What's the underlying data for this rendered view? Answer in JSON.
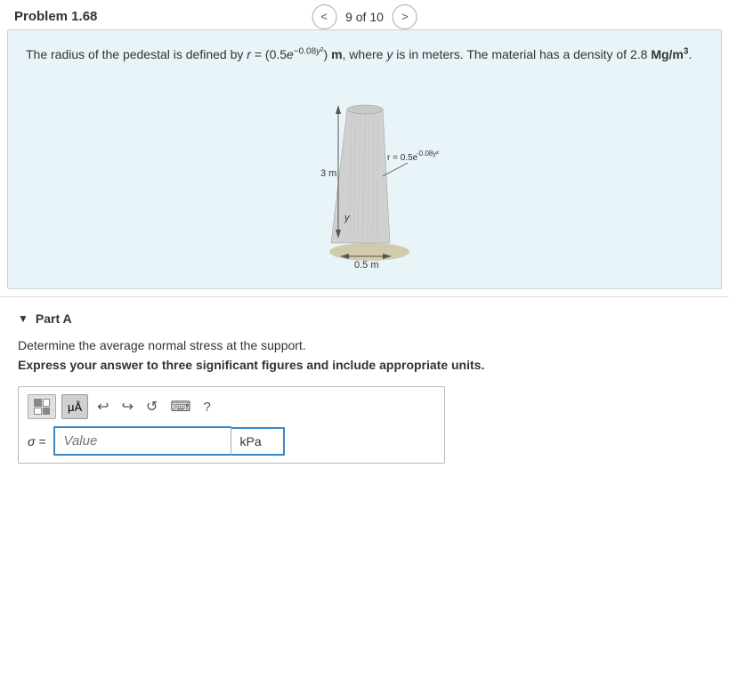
{
  "header": {
    "problem_title": "Problem 1.68",
    "nav": {
      "counter": "9 of 10",
      "prev_label": "<",
      "next_label": ">"
    }
  },
  "problem": {
    "text_parts": {
      "intro": "The radius of the pedestal is defined by ",
      "formula_r": "r = (0.5e",
      "formula_exp": "-0.08y²",
      "formula_unit": ") m,",
      "text_mid": " where ",
      "var_y": "y",
      "text_end": " is in meters. The material has a density of 2.8 ",
      "density_val": "Mg/m",
      "density_exp": "3",
      "density_end": "."
    },
    "figure": {
      "label_3m": "3 m",
      "label_y": "y",
      "label_r": "r = 0.5e",
      "label_r_exp": "-0.08y²",
      "label_05m": "0.5 m"
    }
  },
  "part_a": {
    "header": "Part A",
    "instruction": "Determine the average normal stress at the support.",
    "instruction_bold": "Express your answer to three significant figures and include appropriate units.",
    "sigma_label": "σ =",
    "value_placeholder": "Value",
    "unit": "kPa",
    "toolbar": {
      "matrix_btn": "matrix",
      "mu_btn": "μÅ",
      "undo_btn": "↩",
      "redo_btn": "↪",
      "refresh_btn": "↺",
      "keyboard_btn": "⌨",
      "help_btn": "?"
    }
  }
}
